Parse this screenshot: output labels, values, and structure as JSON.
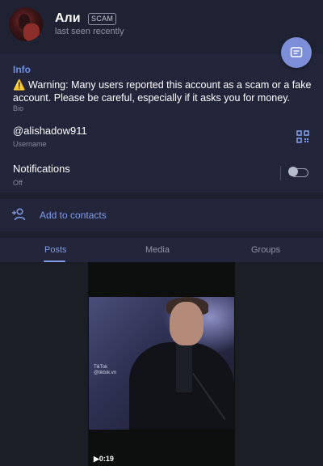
{
  "header": {
    "name": "Али",
    "badge": "SCAM",
    "status": "last seen recently"
  },
  "info": {
    "title": "Info",
    "bio_text": "⚠️ Warning: Many users reported this account as a scam or a fake account. Please be careful, especially if it asks you for money.",
    "bio_label": "Bio",
    "username": "@alishadow911",
    "username_label": "Username",
    "notifications_title": "Notifications",
    "notifications_status": "Off",
    "notifications_enabled": false
  },
  "actions": {
    "add_contact_label": "Add to contacts"
  },
  "tabs": [
    {
      "label": "Posts",
      "active": true
    },
    {
      "label": "Media",
      "active": false
    },
    {
      "label": "Groups",
      "active": false
    }
  ],
  "posts": [
    {
      "type": "video",
      "watermark": "TikTok",
      "watermark_handle": "@tiktok.vn",
      "duration": "0:19"
    }
  ],
  "colors": {
    "accent": "#7f9be8",
    "fab": "#7c8ed8",
    "background": "#1e2030",
    "panel": "#23263a"
  },
  "icons": {
    "fab": "message-icon",
    "username_action": "qr-code-icon",
    "add_contact": "add-person-icon",
    "video": "play-icon"
  }
}
